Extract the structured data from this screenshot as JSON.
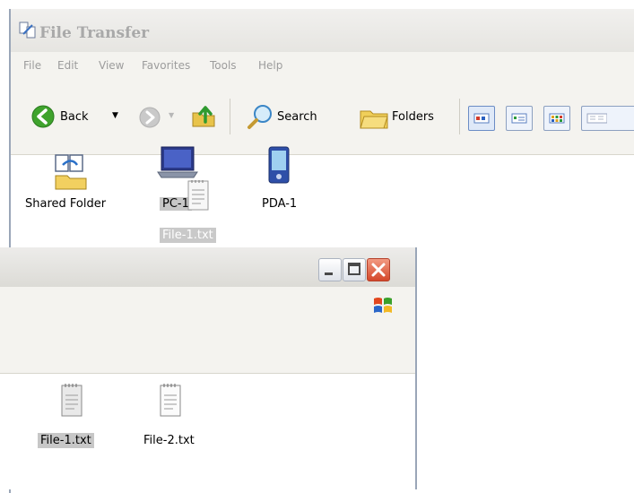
{
  "back_window": {
    "title": "File Transfer",
    "menu": [
      "File",
      "Edit",
      "View",
      "Favorites",
      "Tools",
      "Help"
    ],
    "toolbar": {
      "back_label": "Back",
      "search_label": "Search",
      "folders_label": "Folders"
    },
    "items": [
      {
        "label": "Shared Folder",
        "icon": "shared-folder-icon"
      },
      {
        "label": "PC-1",
        "icon": "laptop-icon"
      },
      {
        "label": "PDA-1",
        "icon": "pda-icon"
      }
    ],
    "drag_label": "File-1.txt"
  },
  "front_window": {
    "files": [
      {
        "label": "File-1.txt",
        "selected": true
      },
      {
        "label": "File-2.txt",
        "selected": false
      }
    ]
  },
  "colors": {
    "selection": "#c7c7c7",
    "close_button": "#d4472a",
    "frame": "#9aa6b8"
  }
}
